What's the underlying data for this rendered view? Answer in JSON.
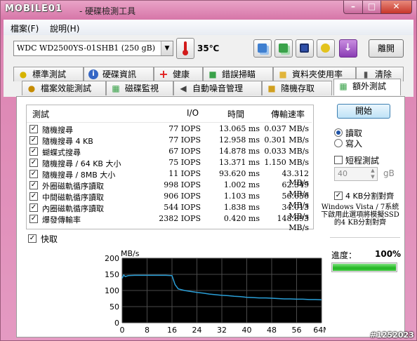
{
  "app": {
    "logo_text": "MOBILE01",
    "title": "- 硬碟檢測工具"
  },
  "menu": [
    "檔案(F)",
    "說明(H)"
  ],
  "toolbar": {
    "drive": "WDC WD2500YS-01SHB1 (250 gB)",
    "temperature": "35℃",
    "exit_label": "離開",
    "buttons": [
      "copy-icon",
      "copy-text-icon",
      "save-icon",
      "options-icon",
      "download-icon"
    ]
  },
  "tabs_top": [
    {
      "label": "標準測試",
      "icon": "lightbulb-icon"
    },
    {
      "label": "硬碟資訊",
      "icon": "info-icon"
    },
    {
      "label": "健康",
      "icon": "health-cross-icon"
    },
    {
      "label": "錯誤掃瞄",
      "icon": "scan-icon"
    },
    {
      "label": "資料夾使用率",
      "icon": "folder-icon"
    },
    {
      "label": "清除",
      "icon": "trash-icon"
    }
  ],
  "tabs_bottom": [
    {
      "label": "檔案效能測試",
      "icon": "file-bulb-icon"
    },
    {
      "label": "磁碟監視",
      "icon": "monitor-icon"
    },
    {
      "label": "自動噪音管理",
      "icon": "speaker-icon"
    },
    {
      "label": "隨機存取",
      "icon": "random-access-icon"
    },
    {
      "label": "額外測試",
      "icon": "extra-test-icon",
      "active": true
    }
  ],
  "table": {
    "headers": [
      "測試",
      "I/O",
      "時間",
      "傳輸速率"
    ],
    "rows": [
      {
        "name": "隨機搜尋",
        "io": "77 IOPS",
        "time": "13.065 ms",
        "rate": "0.037 MB/s"
      },
      {
        "name": "隨機搜尋 4 KB",
        "io": "77 IOPS",
        "time": "12.958 ms",
        "rate": "0.301 MB/s"
      },
      {
        "name": "蝴蝶式搜尋",
        "io": "67 IOPS",
        "time": "14.878 ms",
        "rate": "0.033 MB/s"
      },
      {
        "name": "隨機搜尋 / 64 KB 大小",
        "io": "75 IOPS",
        "time": "13.371 ms",
        "rate": "1.150 MB/s"
      },
      {
        "name": "隨機搜尋 / 8MB 大小",
        "io": "11 IOPS",
        "time": "93.620 ms",
        "rate": "43.312 MB/s"
      },
      {
        "name": "外圈磁軌循序讀取",
        "io": "998 IOPS",
        "time": "1.002 ms",
        "rate": "62.349 MB/s"
      },
      {
        "name": "中間磁軌循序讀取",
        "io": "906 IOPS",
        "time": "1.103 ms",
        "rate": "56.656 MB/s"
      },
      {
        "name": "內圈磁軌循序讀取",
        "io": "544 IOPS",
        "time": "1.838 ms",
        "rate": "34.013 MB/s"
      },
      {
        "name": "爆發傳輸率",
        "io": "2382 IOPS",
        "time": "0.420 ms",
        "rate": "148.893 MB/s"
      }
    ]
  },
  "quick_label": "快取",
  "controls": {
    "start_label": "開始",
    "read_label": "讀取",
    "write_label": "寫入",
    "short_test_label": "短程測試",
    "size_value": "40",
    "size_unit": "gB",
    "align_label": "4 KB分割對齊",
    "note": "Windows Vista / 7系統下啟用此選項將模擬SSD的4 KB分割對齊",
    "progress_label": "進度：",
    "progress_value": "100%",
    "progress_fraction": 1.0
  },
  "watermark": "#1252023",
  "chart_data": {
    "type": "line",
    "ylabel": "MB/s",
    "ylim": [
      0,
      200
    ],
    "yticks": [
      "200",
      "150",
      "100",
      "50",
      "0"
    ],
    "xlim": [
      0,
      64
    ],
    "xticks": [
      "0",
      "8",
      "16",
      "24",
      "32",
      "40",
      "48",
      "56",
      "64M"
    ],
    "series": [
      {
        "color": "#2a9fd8",
        "x": [
          0,
          0.5,
          1,
          2,
          4,
          8,
          12,
          14,
          16,
          16.5,
          17,
          18,
          20,
          22,
          24,
          26,
          28,
          30,
          32,
          34,
          36,
          38,
          40,
          42,
          44,
          46,
          48,
          50,
          52,
          54,
          56,
          58,
          60,
          62,
          64
        ],
        "y": [
          138,
          148,
          143,
          146,
          147,
          147,
          147,
          147,
          146,
          132,
          118,
          105,
          100,
          97,
          94,
          92,
          89,
          87,
          85,
          84,
          82,
          81,
          79,
          78,
          77,
          77,
          76,
          75,
          74,
          74,
          73,
          73,
          72,
          72,
          71
        ]
      }
    ],
    "background": "#000000",
    "grid": true,
    "grid_color": "#4a4a4a"
  }
}
